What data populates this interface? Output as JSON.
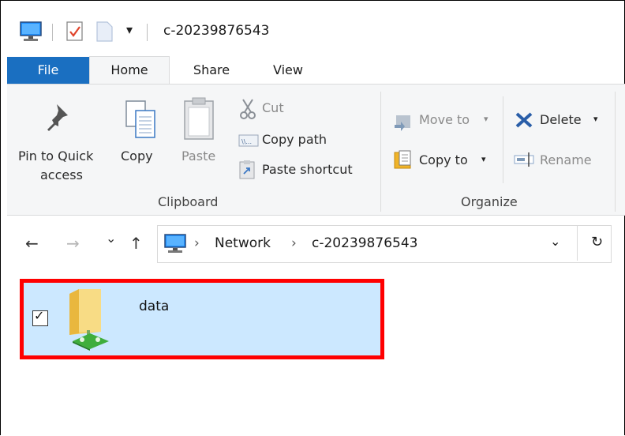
{
  "window": {
    "title": "c-20239876543"
  },
  "quick_access": {
    "separator": "|",
    "dropdown_glyph": "▾"
  },
  "tabs": [
    {
      "label": "File"
    },
    {
      "label": "Home"
    },
    {
      "label": "Share"
    },
    {
      "label": "View"
    }
  ],
  "ribbon": {
    "clipboard": {
      "group_label": "Clipboard",
      "pin_label_line1": "Pin to Quick",
      "pin_label_line2": "access",
      "copy_label": "Copy",
      "paste_label": "Paste",
      "cut_label": "Cut",
      "copy_path_label": "Copy path",
      "paste_shortcut_label": "Paste shortcut"
    },
    "organize": {
      "group_label": "Organize",
      "move_to_label": "Move to",
      "copy_to_label": "Copy to",
      "delete_label": "Delete",
      "rename_label": "Rename"
    }
  },
  "address_bar": {
    "crumbs": [
      "Network",
      "c-20239876543"
    ],
    "separator": "›",
    "back_glyph": "←",
    "forward_glyph": "→",
    "recent_glyph": "⌄",
    "up_glyph": "↑",
    "dropdown_glyph": "⌄",
    "refresh_glyph": "↻"
  },
  "files": [
    {
      "name": "data",
      "selected": true,
      "checked": true,
      "check_glyph": "✓"
    }
  ],
  "colors": {
    "file_tab": "#1a6fc1",
    "selection": "#cce8ff",
    "highlight_box": "#ff0000"
  }
}
